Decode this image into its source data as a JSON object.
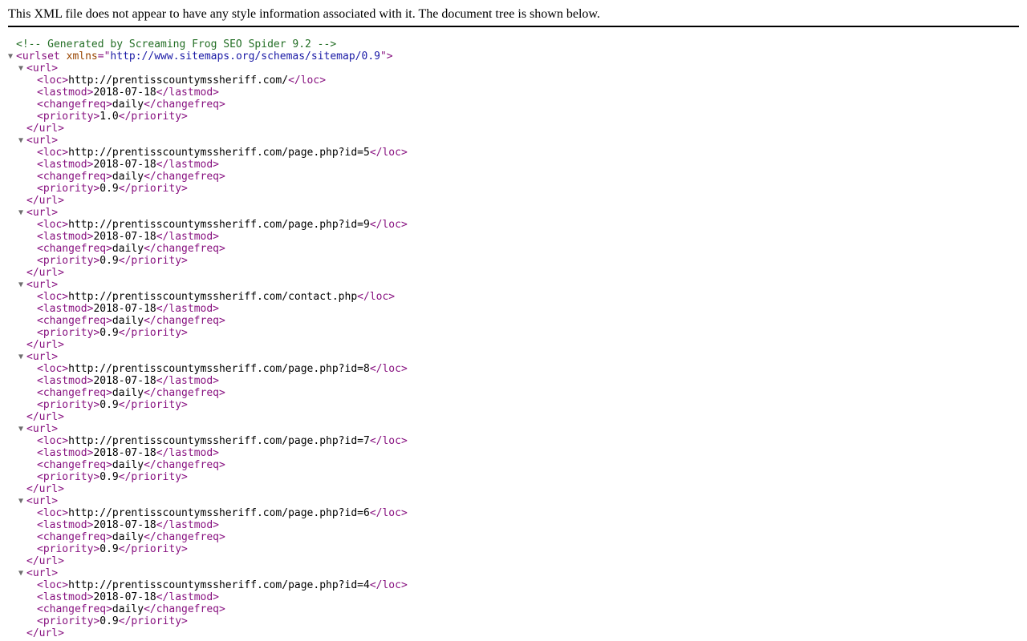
{
  "info_message": "This XML file does not appear to have any style information associated with it. The document tree is shown below.",
  "comment": "<!-- Generated by Screaming Frog SEO Spider 9.2 -->",
  "toggle_glyph": "▼",
  "urlset": {
    "open_tag_start": "<urlset",
    "attr_name": "xmlns",
    "attr_eq": "=\"",
    "attr_value": "http://www.sitemaps.org/schemas/sitemap/0.9",
    "open_tag_end": "\">"
  },
  "tags": {
    "url_open": "<url>",
    "url_close": "</url>",
    "loc_open": "<loc>",
    "loc_close": "</loc>",
    "lastmod_open": "<lastmod>",
    "lastmod_close": "</lastmod>",
    "changefreq_open": "<changefreq>",
    "changefreq_close": "</changefreq>",
    "priority_open": "<priority>",
    "priority_close": "</priority>"
  },
  "urls": [
    {
      "loc": "http://prentisscountymssheriff.com/",
      "lastmod": "2018-07-18",
      "changefreq": "daily",
      "priority": "1.0"
    },
    {
      "loc": "http://prentisscountymssheriff.com/page.php?id=5",
      "lastmod": "2018-07-18",
      "changefreq": "daily",
      "priority": "0.9"
    },
    {
      "loc": "http://prentisscountymssheriff.com/page.php?id=9",
      "lastmod": "2018-07-18",
      "changefreq": "daily",
      "priority": "0.9"
    },
    {
      "loc": "http://prentisscountymssheriff.com/contact.php",
      "lastmod": "2018-07-18",
      "changefreq": "daily",
      "priority": "0.9"
    },
    {
      "loc": "http://prentisscountymssheriff.com/page.php?id=8",
      "lastmod": "2018-07-18",
      "changefreq": "daily",
      "priority": "0.9"
    },
    {
      "loc": "http://prentisscountymssheriff.com/page.php?id=7",
      "lastmod": "2018-07-18",
      "changefreq": "daily",
      "priority": "0.9"
    },
    {
      "loc": "http://prentisscountymssheriff.com/page.php?id=6",
      "lastmod": "2018-07-18",
      "changefreq": "daily",
      "priority": "0.9"
    },
    {
      "loc": "http://prentisscountymssheriff.com/page.php?id=4",
      "lastmod": "2018-07-18",
      "changefreq": "daily",
      "priority": "0.9"
    }
  ]
}
